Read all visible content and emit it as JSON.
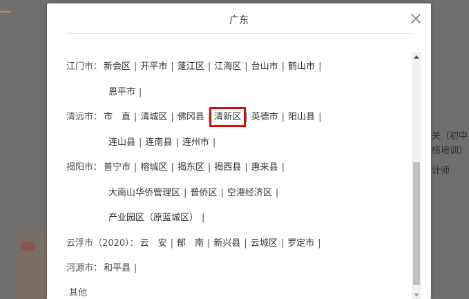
{
  "modal": {
    "title": "广东"
  },
  "background": {
    "text1": "关（初中",
    "text2": "络培训）",
    "text3": "计师"
  },
  "regions": [
    {
      "label": "江门市：",
      "lines": [
        [
          "新会区",
          "开平市",
          "蓬江区",
          "江海区",
          "台山市",
          "鹤山市"
        ],
        [
          "恩平市"
        ]
      ]
    },
    {
      "label": "清远市：",
      "lines": [
        [
          "市　直",
          "清城区",
          "佛冈县",
          "清新区",
          "英德市",
          "阳山县"
        ],
        [
          "连山县",
          "连南县",
          "连州市"
        ]
      ]
    },
    {
      "label": "揭阳市：",
      "lines": [
        [
          "普宁市",
          "榕城区",
          "揭东区",
          "揭西县",
          "惠来县"
        ],
        [
          "大南山华侨管理区",
          "普侨区",
          "空港经济区"
        ],
        [
          "产业园区（原蓝城区）"
        ]
      ]
    },
    {
      "label": "云浮市（2020）：",
      "lines": [
        [
          "云　安",
          "郁　南",
          "新兴县",
          "云城区",
          "罗定市"
        ]
      ]
    },
    {
      "label": "河源市：",
      "lines": [
        [
          "和平县"
        ]
      ]
    },
    {
      "label": "其他",
      "lines": []
    }
  ]
}
